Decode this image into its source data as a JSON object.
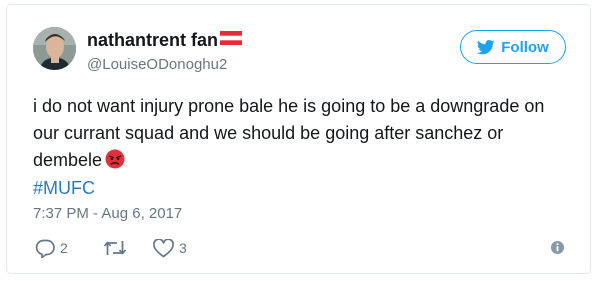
{
  "tweet": {
    "display_name": "nathantrent fan",
    "handle": "@LouiseODonoghu2",
    "follow_label": "Follow",
    "text": "i do not want injury prone bale he is going to be a downgrade on our currant squad and we should be going after sanchez or dembele",
    "hashtag": "#MUFC",
    "timestamp": "7:37 PM - Aug 6, 2017",
    "reply_count": "2",
    "like_count": "3"
  },
  "icons": {
    "follow": "twitter-bird-icon",
    "name_flag": "austria-flag-icon",
    "emoji": "angry-face-emoji",
    "reply": "reply-icon",
    "retweet": "retweet-icon",
    "like": "heart-icon",
    "info": "info-icon"
  },
  "colors": {
    "accent": "#1da1f2",
    "hashtag": "#2b7bb9",
    "secondary_text": "#657786",
    "primary_text": "#14171a",
    "border": "#e1e8ed"
  }
}
